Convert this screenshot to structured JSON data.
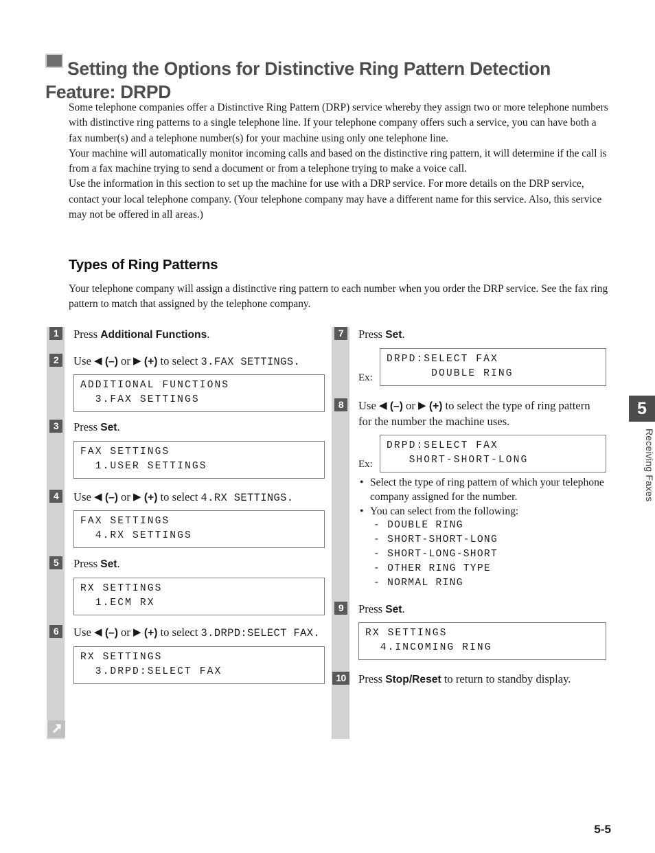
{
  "heading": {
    "title": "Setting the Options for Distinctive Ring Pattern Detection Feature: DRPD",
    "bullet_icon": "filled-square-icon"
  },
  "intro": {
    "p1": "Some telephone companies offer a Distinctive Ring Pattern (DRP) service whereby they assign two or more telephone numbers with distinctive ring patterns to a single telephone line. If your telephone company offers such a service, you can have both a fax number(s) and a telephone number(s) for your machine using only one telephone line.",
    "p2": "Your machine will automatically monitor incoming calls and based on the distinctive ring pattern, it will determine if the call is from a fax machine trying to send a document or from a telephone trying to make a voice call.",
    "p3": "Use the information in this section to set up the machine for use with a DRP service. For more details on the DRP service, contact your local telephone company. (Your telephone company may have a different name for this service. Also, this service may not be offered in all areas.)"
  },
  "section": {
    "subheading": "Types of Ring Patterns",
    "p1": "Your telephone company will assign a distinctive ring pattern to each number when you order the DRP service. See the fax ring pattern to match that assigned by the telephone company."
  },
  "steps_left": [
    {
      "number": "1",
      "parts": [
        {
          "t": "text",
          "v": "Press "
        },
        {
          "t": "bold",
          "v": "Additional Functions"
        },
        {
          "t": "text",
          "v": "."
        }
      ]
    },
    {
      "number": "2",
      "parts": [
        {
          "t": "text",
          "v": "Use "
        },
        {
          "t": "icon",
          "v": "◀",
          "name": "left-arrow-icon"
        },
        {
          "t": "pm",
          "v": " (–)"
        },
        {
          "t": "text",
          "v": " or "
        },
        {
          "t": "icon",
          "v": "▶",
          "name": "right-arrow-icon"
        },
        {
          "t": "pm",
          "v": " (+)"
        },
        {
          "t": "text",
          "v": " to select "
        },
        {
          "t": "mono",
          "v": "3.FAX SETTINGS"
        },
        {
          "t": "mono",
          "v": "."
        }
      ],
      "lcd": {
        "line1": "ADDITIONAL FUNCTIONS",
        "line2": "  3.FAX SETTINGS"
      }
    },
    {
      "number": "3",
      "parts": [
        {
          "t": "text",
          "v": "Press "
        },
        {
          "t": "bold",
          "v": "Set"
        },
        {
          "t": "text",
          "v": "."
        }
      ],
      "lcd": {
        "line1": "FAX SETTINGS",
        "line2": "  1.USER SETTINGS"
      }
    },
    {
      "number": "4",
      "parts": [
        {
          "t": "text",
          "v": "Use "
        },
        {
          "t": "icon",
          "v": "◀",
          "name": "left-arrow-icon"
        },
        {
          "t": "pm",
          "v": " (–)"
        },
        {
          "t": "text",
          "v": " or "
        },
        {
          "t": "icon",
          "v": "▶",
          "name": "right-arrow-icon"
        },
        {
          "t": "pm",
          "v": " (+)"
        },
        {
          "t": "text",
          "v": " to select "
        },
        {
          "t": "mono",
          "v": "4.RX SETTINGS"
        },
        {
          "t": "mono",
          "v": "."
        }
      ],
      "lcd": {
        "line1": "FAX SETTINGS",
        "line2": "  4.RX SETTINGS"
      }
    },
    {
      "number": "5",
      "parts": [
        {
          "t": "text",
          "v": "Press "
        },
        {
          "t": "bold",
          "v": "Set"
        },
        {
          "t": "text",
          "v": "."
        }
      ],
      "lcd": {
        "line1": "RX SETTINGS",
        "line2": "  1.ECM RX"
      }
    },
    {
      "number": "6",
      "parts": [
        {
          "t": "text",
          "v": "Use "
        },
        {
          "t": "icon",
          "v": "◀",
          "name": "left-arrow-icon"
        },
        {
          "t": "pm",
          "v": " (–)"
        },
        {
          "t": "text",
          "v": " or "
        },
        {
          "t": "icon",
          "v": "▶",
          "name": "right-arrow-icon"
        },
        {
          "t": "pm",
          "v": " (+)"
        },
        {
          "t": "text",
          "v": " to select "
        },
        {
          "t": "mono",
          "v": "3.DRPD:SELECT FAX"
        },
        {
          "t": "mono",
          "v": "."
        }
      ],
      "lcd": {
        "line1": "RX SETTINGS",
        "line2": "  3.DRPD:SELECT FAX"
      }
    }
  ],
  "steps_right": [
    {
      "number": "7",
      "parts": [
        {
          "t": "text",
          "v": "Press "
        },
        {
          "t": "bold",
          "v": "Set"
        },
        {
          "t": "text",
          "v": "."
        }
      ],
      "ex_label": "Ex:",
      "lcd": {
        "line1": "DRPD:SELECT FAX",
        "line2": "      DOUBLE RING"
      }
    },
    {
      "number": "8",
      "parts": [
        {
          "t": "text",
          "v": "Use "
        },
        {
          "t": "icon",
          "v": "◀",
          "name": "left-arrow-icon"
        },
        {
          "t": "pm",
          "v": " (–)"
        },
        {
          "t": "text",
          "v": " or "
        },
        {
          "t": "icon",
          "v": "▶",
          "name": "right-arrow-icon"
        },
        {
          "t": "pm",
          "v": " (+)"
        },
        {
          "t": "text",
          "v": " to select the type of ring pattern for the number the machine uses."
        }
      ],
      "ex_label": "Ex:",
      "lcd": {
        "line1": "DRPD:SELECT FAX",
        "line2": "   SHORT-SHORT-LONG"
      }
    },
    {
      "number": "9",
      "parts": [
        {
          "t": "text",
          "v": "Press "
        },
        {
          "t": "bold",
          "v": "Set"
        },
        {
          "t": "text",
          "v": "."
        }
      ],
      "lcd": {
        "line1": "RX SETTINGS",
        "line2": "  4.INCOMING RING"
      }
    },
    {
      "number": "10",
      "parts": [
        {
          "t": "text",
          "v": "Press "
        },
        {
          "t": "bold",
          "v": "Stop/Reset"
        },
        {
          "t": "text",
          "v": " to return to standby display."
        }
      ]
    }
  ],
  "notes": {
    "bullet1": "Select the type of ring pattern of which your telephone company assigned for the number.",
    "bullet2": "You can select from the following:",
    "options": [
      "- DOUBLE RING",
      "- SHORT-SHORT-LONG",
      "- SHORT-LONG-SHORT",
      "- OTHER RING TYPE",
      "- NORMAL RING"
    ]
  },
  "tab": {
    "number": "5",
    "label": "Receiving Faxes"
  },
  "footer": {
    "page": "5-5"
  },
  "markers": {
    "continuation_icon": "diagonal-arrow-up-right-icon"
  },
  "colors": {
    "strip": "#d2d2d2",
    "badge": "#595959",
    "tab": "#4d4d4d",
    "heading": "#4d4d4d",
    "lcd_border": "#7a7a7a"
  }
}
